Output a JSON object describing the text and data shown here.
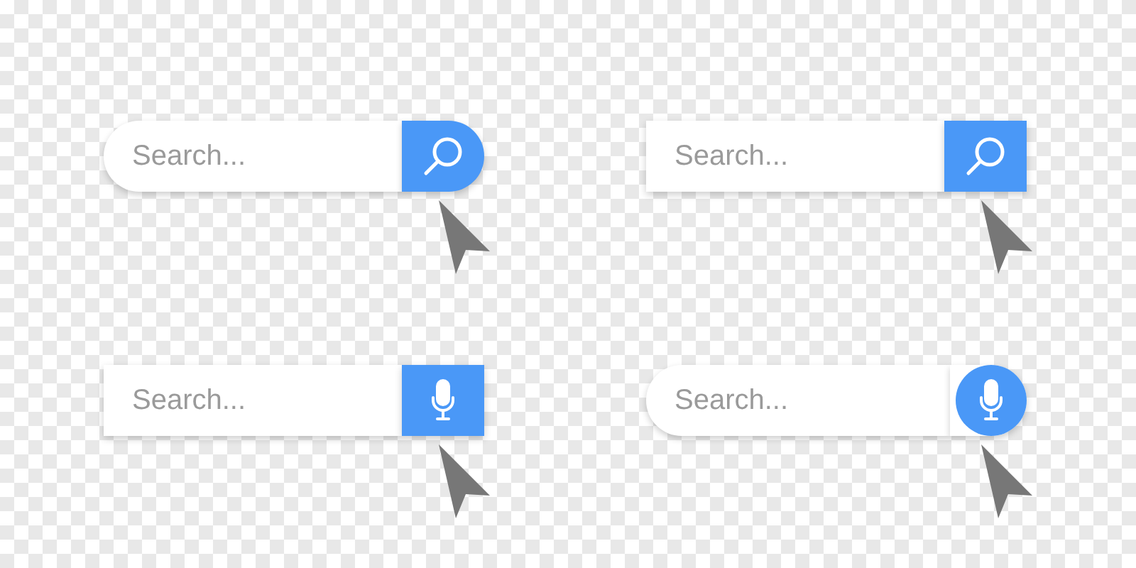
{
  "search_bars": [
    {
      "placeholder": "Search...",
      "kind": "pill-search"
    },
    {
      "placeholder": "Search...",
      "kind": "square-search"
    },
    {
      "placeholder": "Search...",
      "kind": "square-mic"
    },
    {
      "placeholder": "Search...",
      "kind": "circle-mic"
    }
  ]
}
